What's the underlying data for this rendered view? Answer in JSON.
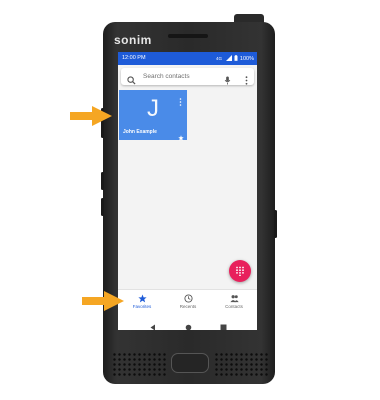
{
  "device": {
    "brand": "sonim"
  },
  "status_bar": {
    "time": "12:00 PM",
    "battery": "100%",
    "icons": [
      "volte-icon",
      "signal-icon",
      "battery-icon"
    ]
  },
  "search": {
    "placeholder": "Search contacts",
    "icons": [
      "search-icon",
      "mic-icon",
      "more-vert-icon"
    ]
  },
  "favorites": [
    {
      "initial": "J",
      "name": "John Example",
      "starred": true
    }
  ],
  "fab": {
    "icon": "dialpad-icon"
  },
  "bottom_nav": {
    "active": "Favorites",
    "tabs": [
      {
        "label": "Favorites",
        "icon": "star-icon"
      },
      {
        "label": "Recents",
        "icon": "clock-icon"
      },
      {
        "label": "Contacts",
        "icon": "people-icon"
      }
    ]
  },
  "system_nav": [
    "back-icon",
    "home-icon",
    "recents-icon"
  ],
  "colors": {
    "accent": "#1e5bd8",
    "tile": "#4a8be8",
    "fab": "#e8215c",
    "callout_arrow": "#f5a623"
  }
}
